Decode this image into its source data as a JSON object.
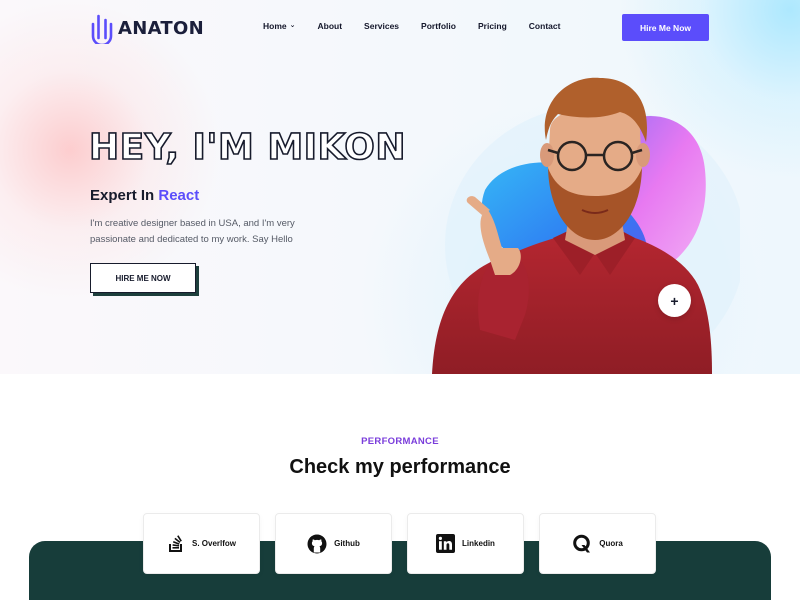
{
  "brand": {
    "name": "ANATON",
    "accent_color": "#5b4dfb"
  },
  "nav": {
    "items": [
      {
        "label": "Home",
        "has_dropdown": true
      },
      {
        "label": "About"
      },
      {
        "label": "Services"
      },
      {
        "label": "Portfolio"
      },
      {
        "label": "Pricing"
      },
      {
        "label": "Contact"
      }
    ],
    "cta_label": "Hire Me Now"
  },
  "hero": {
    "title": "HEY, I'M MIKON",
    "subtitle_prefix": "Expert In",
    "subtitle_accent": "React",
    "description": "I'm creative designer based in USA, and I'm very passionate and dedicated to my work. Say Hello",
    "cta_label": "HIRE ME NOW",
    "plus_label": "+"
  },
  "performance": {
    "label": "PERFORMANCE",
    "title": "Check my performance",
    "label_color": "#7a3ddb",
    "panel_color": "#173d3a",
    "cards": [
      {
        "label": "S. Overlfow",
        "icon": "stack-overflow-icon"
      },
      {
        "label": "Github",
        "icon": "github-icon"
      },
      {
        "label": "Linkedin",
        "icon": "linkedin-icon"
      },
      {
        "label": "Quora",
        "icon": "quora-icon"
      }
    ]
  }
}
